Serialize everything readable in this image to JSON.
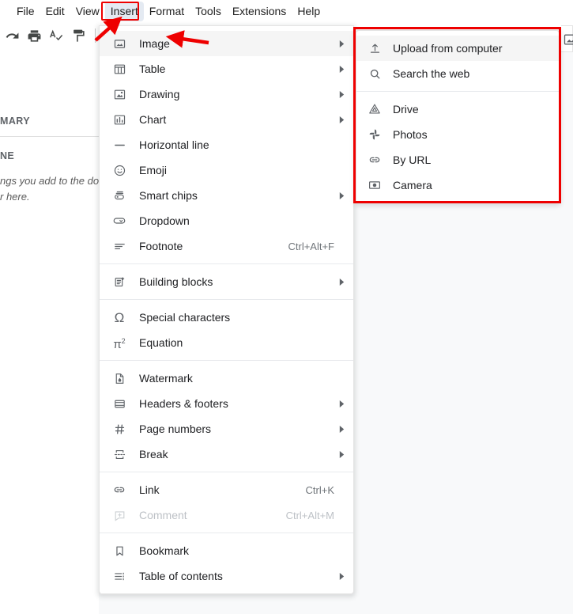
{
  "menubar": {
    "items": [
      {
        "label": "File",
        "active": false
      },
      {
        "label": "Edit",
        "active": false
      },
      {
        "label": "View",
        "active": false
      },
      {
        "label": "Insert",
        "active": true
      },
      {
        "label": "Format",
        "active": false
      },
      {
        "label": "Tools",
        "active": false
      },
      {
        "label": "Extensions",
        "active": false
      },
      {
        "label": "Help",
        "active": false
      }
    ]
  },
  "toolbar": {
    "icons": [
      "redo-icon",
      "print-icon",
      "spelling-check-icon",
      "paint-format-icon"
    ]
  },
  "outline": {
    "heading_1": "MARY",
    "heading_2": "NE",
    "body_line_1": "ngs you add to the do",
    "body_line_2": "r here."
  },
  "insert_menu": {
    "groups": [
      {
        "items": [
          {
            "label": "Image",
            "icon": "image-icon",
            "submenu": true,
            "accel": "",
            "disabled": false,
            "highlight": true
          },
          {
            "label": "Table",
            "icon": "table-icon",
            "submenu": true,
            "accel": "",
            "disabled": false,
            "highlight": false
          },
          {
            "label": "Drawing",
            "icon": "drawing-icon",
            "submenu": true,
            "accel": "",
            "disabled": false,
            "highlight": false
          },
          {
            "label": "Chart",
            "icon": "chart-icon",
            "submenu": true,
            "accel": "",
            "disabled": false,
            "highlight": false
          },
          {
            "label": "Horizontal line",
            "icon": "horizontal-line-icon",
            "submenu": false,
            "accel": "",
            "disabled": false,
            "highlight": false
          },
          {
            "label": "Emoji",
            "icon": "emoji-icon",
            "submenu": false,
            "accel": "",
            "disabled": false,
            "highlight": false
          },
          {
            "label": "Smart chips",
            "icon": "smart-chips-icon",
            "submenu": true,
            "accel": "",
            "disabled": false,
            "highlight": false
          },
          {
            "label": "Dropdown",
            "icon": "dropdown-icon",
            "submenu": false,
            "accel": "",
            "disabled": false,
            "highlight": false
          },
          {
            "label": "Footnote",
            "icon": "footnote-icon",
            "submenu": false,
            "accel": "Ctrl+Alt+F",
            "disabled": false,
            "highlight": false
          }
        ]
      },
      {
        "items": [
          {
            "label": "Building blocks",
            "icon": "building-blocks-icon",
            "submenu": true,
            "accel": "",
            "disabled": false,
            "highlight": false
          }
        ]
      },
      {
        "items": [
          {
            "label": "Special characters",
            "icon": "omega-icon",
            "submenu": false,
            "accel": "",
            "disabled": false,
            "highlight": false
          },
          {
            "label": "Equation",
            "icon": "equation-icon",
            "submenu": false,
            "accel": "",
            "disabled": false,
            "highlight": false
          }
        ]
      },
      {
        "items": [
          {
            "label": "Watermark",
            "icon": "watermark-icon",
            "submenu": false,
            "accel": "",
            "disabled": false,
            "highlight": false
          },
          {
            "label": "Headers & footers",
            "icon": "headers-footers-icon",
            "submenu": true,
            "accel": "",
            "disabled": false,
            "highlight": false
          },
          {
            "label": "Page numbers",
            "icon": "page-numbers-icon",
            "submenu": true,
            "accel": "",
            "disabled": false,
            "highlight": false
          },
          {
            "label": "Break",
            "icon": "break-icon",
            "submenu": true,
            "accel": "",
            "disabled": false,
            "highlight": false
          }
        ]
      },
      {
        "items": [
          {
            "label": "Link",
            "icon": "link-icon",
            "submenu": false,
            "accel": "Ctrl+K",
            "disabled": false,
            "highlight": false
          },
          {
            "label": "Comment",
            "icon": "comment-icon",
            "submenu": false,
            "accel": "Ctrl+Alt+M",
            "disabled": true,
            "highlight": false
          }
        ]
      },
      {
        "items": [
          {
            "label": "Bookmark",
            "icon": "bookmark-icon",
            "submenu": false,
            "accel": "",
            "disabled": false,
            "highlight": false
          },
          {
            "label": "Table of contents",
            "icon": "table-of-contents-icon",
            "submenu": true,
            "accel": "",
            "disabled": false,
            "highlight": false
          }
        ]
      }
    ]
  },
  "image_submenu": {
    "groups": [
      {
        "items": [
          {
            "label": "Upload from computer",
            "icon": "upload-icon",
            "highlight": true
          },
          {
            "label": "Search the web",
            "icon": "search-icon",
            "highlight": false
          }
        ]
      },
      {
        "items": [
          {
            "label": "Drive",
            "icon": "drive-icon",
            "highlight": false
          },
          {
            "label": "Photos",
            "icon": "photos-icon",
            "highlight": false
          },
          {
            "label": "By URL",
            "icon": "link-icon",
            "highlight": false
          },
          {
            "label": "Camera",
            "icon": "camera-icon",
            "highlight": false
          }
        ]
      }
    ]
  },
  "annotations": {
    "highlight_color": "#ee0000",
    "arrows": [
      "arrow-to-insert-menu",
      "arrow-to-image-item"
    ],
    "boxes": [
      "box-around-insert-menu",
      "box-around-image-submenu"
    ]
  }
}
